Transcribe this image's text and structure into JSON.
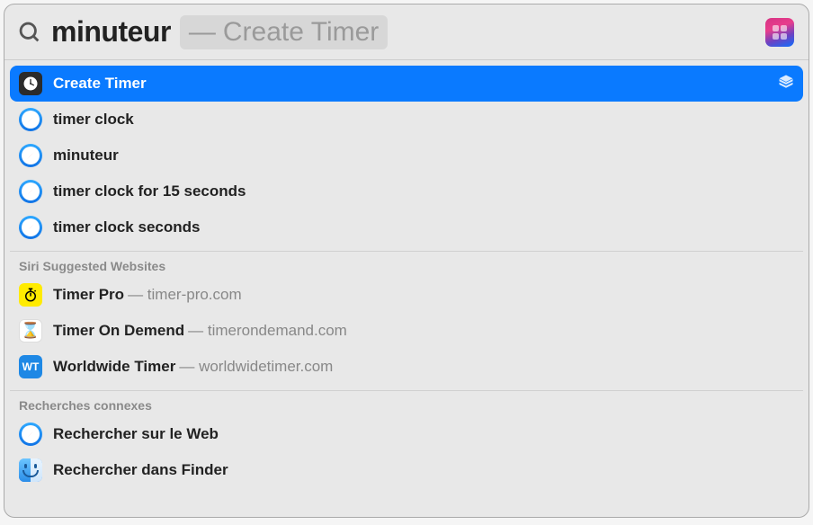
{
  "search": {
    "query": "minuteur",
    "completion_label": "Create Timer"
  },
  "top_hit": {
    "label": "Create Timer"
  },
  "safari_suggestions": [
    {
      "label": "timer clock"
    },
    {
      "label": "minuteur"
    },
    {
      "label": "timer clock for 15 seconds"
    },
    {
      "label": "timer clock seconds"
    }
  ],
  "siri_section": {
    "heading": "Siri Suggested Websites",
    "items": [
      {
        "icon": "timer-pro",
        "title": "Timer Pro",
        "url": "timer-pro.com"
      },
      {
        "icon": "hourglass",
        "title": "Timer On Demend",
        "url": "timerondemand.com"
      },
      {
        "icon": "wt",
        "title": "Worldwide Timer",
        "url": "worldwidetimer.com"
      }
    ]
  },
  "related_section": {
    "heading": "Recherches connexes",
    "items": [
      {
        "icon": "safari",
        "label": "Rechercher sur le Web"
      },
      {
        "icon": "finder",
        "label": "Rechercher dans Finder"
      }
    ]
  },
  "wt_text": "WT"
}
